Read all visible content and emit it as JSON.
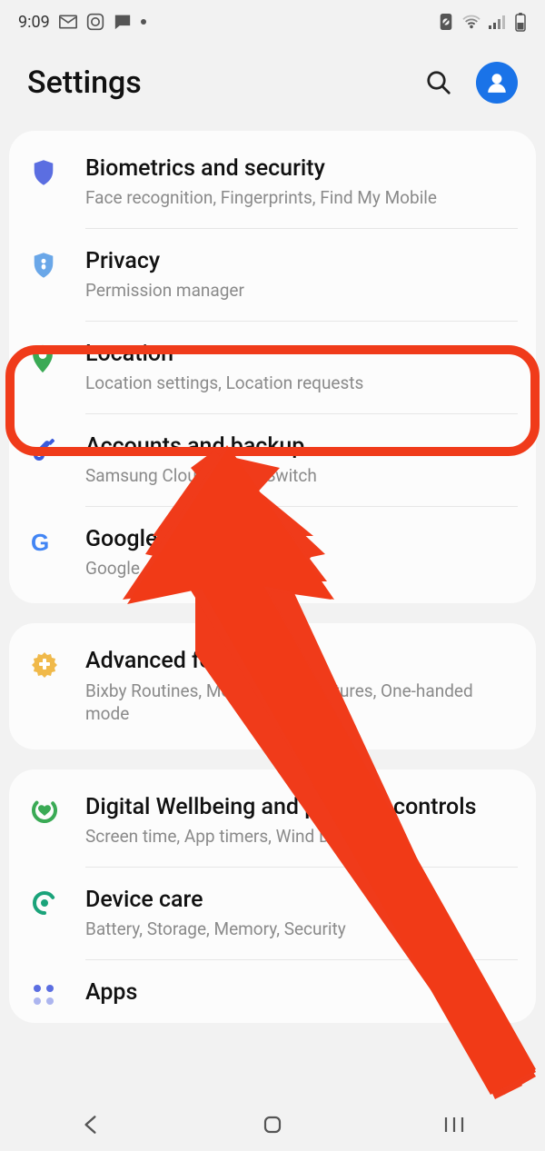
{
  "status": {
    "time": "9:09"
  },
  "header": {
    "title": "Settings"
  },
  "groups": [
    {
      "items": [
        {
          "key": "biometrics",
          "title": "Biometrics and security",
          "sub": "Face recognition, Fingerprints, Find My Mobile"
        },
        {
          "key": "privacy",
          "title": "Privacy",
          "sub": "Permission manager"
        },
        {
          "key": "location",
          "title": "Location",
          "sub": "Location settings, Location requests"
        },
        {
          "key": "accounts",
          "title": "Accounts and backup",
          "sub": "Samsung Cloud, Smart Switch"
        },
        {
          "key": "google",
          "title": "Google",
          "sub": "Google settings"
        }
      ]
    },
    {
      "items": [
        {
          "key": "advanced",
          "title": "Advanced features",
          "sub": "Bixby Routines, Motions and gestures, One-handed mode"
        }
      ]
    },
    {
      "items": [
        {
          "key": "wellbeing",
          "title": "Digital Wellbeing and parental controls",
          "sub": "Screen time, App timers, Wind Down"
        },
        {
          "key": "devicecare",
          "title": "Device care",
          "sub": "Battery, Storage, Memory, Security"
        },
        {
          "key": "apps",
          "title": "Apps",
          "sub": ""
        }
      ]
    }
  ]
}
